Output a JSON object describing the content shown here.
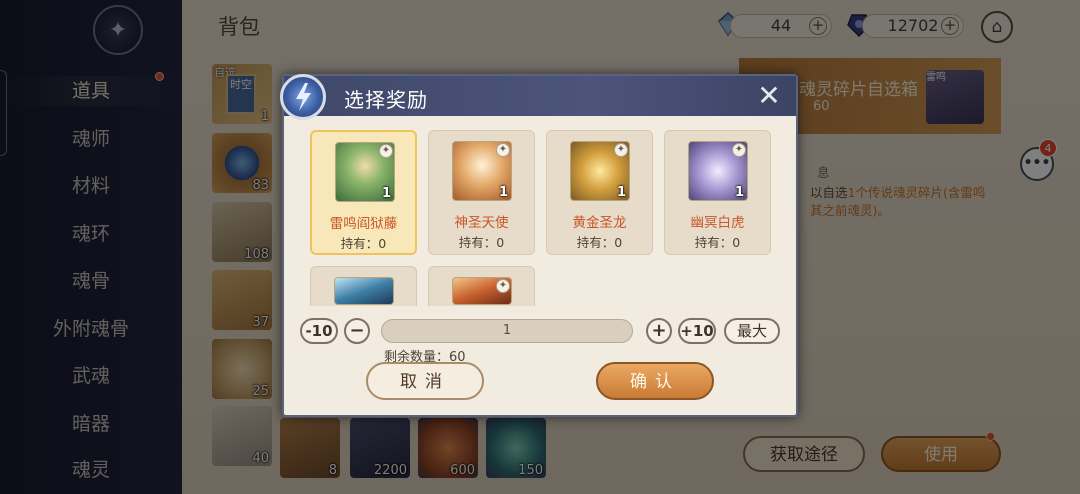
{
  "sidebar": {
    "items": [
      {
        "label": "道具",
        "active": true
      },
      {
        "label": "魂师"
      },
      {
        "label": "材料"
      },
      {
        "label": "魂环"
      },
      {
        "label": "魂骨"
      },
      {
        "label": "外附魂骨"
      },
      {
        "label": "武魂"
      },
      {
        "label": "暗器"
      },
      {
        "label": "魂灵"
      }
    ]
  },
  "header": {
    "title": "背包",
    "currency_1": "44",
    "currency_2": "12702"
  },
  "inventory": {
    "col1": [
      {
        "tag": "自选",
        "art": "时空",
        "count": "1"
      },
      {
        "count": "83"
      },
      {
        "count": "108"
      },
      {
        "count": "37"
      },
      {
        "count": "25"
      },
      {
        "count": "40"
      }
    ],
    "bottom_row": [
      "8",
      "2200",
      "600",
      "150"
    ]
  },
  "detail": {
    "title": "魂灵碎片自选箱",
    "corner_label": "雷鸣",
    "count": "60",
    "label": "息",
    "desc_prefix": "以自选",
    "desc_highlight": "1个传说魂灵碎片(含雷鸣",
    "desc_line2": "其之前魂灵)。",
    "get_source": "获取途径",
    "use": "使用",
    "chat_badge": "4"
  },
  "modal": {
    "title": "选择奖励",
    "rewards": [
      {
        "name": "雷鸣阎狱藤",
        "owned": "持有：0",
        "num": "1"
      },
      {
        "name": "神圣天使",
        "owned": "持有：0",
        "num": "1"
      },
      {
        "name": "黄金圣龙",
        "owned": "持有：0",
        "num": "1"
      },
      {
        "name": "幽冥白虎",
        "owned": "持有：0",
        "num": "1"
      }
    ],
    "minus10": "-10",
    "minus": "−",
    "quantity": "1",
    "plus": "+",
    "plus10": "+10",
    "max": "最大",
    "remaining": "剩余数量：60",
    "cancel": "取消",
    "confirm": "确认"
  },
  "colors": {
    "accent_orange": "#c8572a",
    "selected_gold": "#f0c35c",
    "modal_header": "#454f73"
  }
}
